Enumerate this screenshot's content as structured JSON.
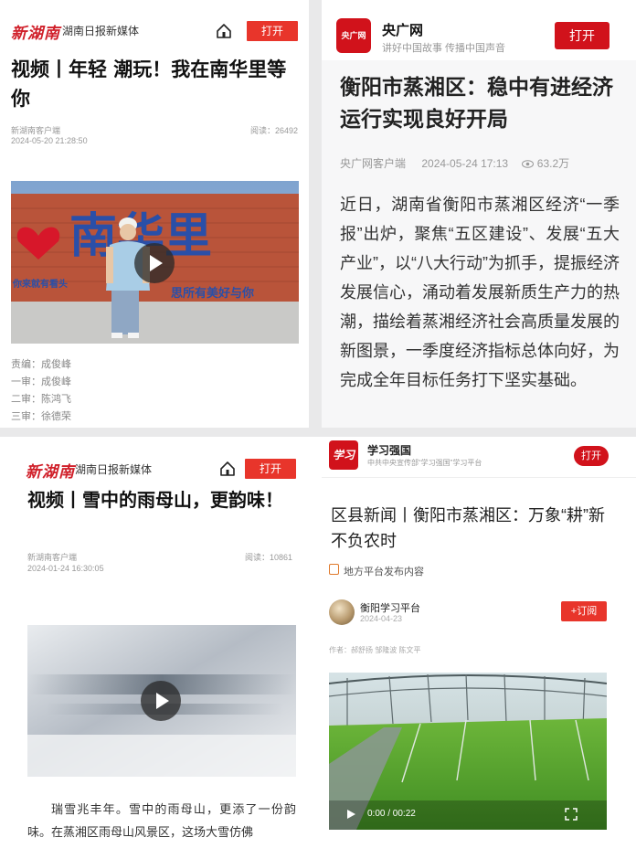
{
  "panel_a": {
    "logo": "新湖南",
    "source": "湖南日报新媒体",
    "open": "打开",
    "title": "视频丨年轻 潮玩！我在南华里等你",
    "author": "新湖南客户端",
    "datetime": "2024-05-20 21:28:50",
    "reads": "阅读：26492",
    "editors": [
      "责编：成俊峰",
      "一审：成俊峰",
      "二审：陈鸿飞",
      "三审：徐德荣"
    ],
    "video_sign": "南华里",
    "video_sign_sub": "思所有美好与你",
    "video_left_text": "你来就有看头"
  },
  "panel_b": {
    "brand": "央广网",
    "logo_text": "央广网",
    "slogan": "讲好中国故事 传播中国声音",
    "open": "打开",
    "title": "衡阳市蒸湘区：稳中有进经济运行实现良好开局",
    "source": "央广网客户端",
    "datetime": "2024-05-24 17:13",
    "views": "63.2万",
    "body": "近日，湖南省衡阳市蒸湘区经济“一季报”出炉，聚焦“五区建设”、发展“五大产业”，以“八大行动”为抓手，提振经济发展信心，涌动着发展新质生产力的热潮，描绘着蒸湘经济社会高质量发展的新图景，一季度经济指标总体向好，为完成全年目标任务打下坚实基础。"
  },
  "panel_c": {
    "logo": "新湖南",
    "source": "湖南日报新媒体",
    "open": "打开",
    "title": "视频丨雪中的雨母山，更韵味！",
    "author": "新湖南客户端",
    "datetime": "2024-01-24 16:30:05",
    "reads": "阅读：10861",
    "body": "瑞雪兆丰年。雪中的雨母山，更添了一份韵味。在蒸湘区雨母山风景区，这场大雪仿佛"
  },
  "panel_d": {
    "brand": "学习强国",
    "logo_text": "学习",
    "subtitle": "中共中央宣传部“学习强国”学习平台",
    "open": "打开",
    "title": "区县新闻丨衡阳市蒸湘区：万象“耕”新 不负农时",
    "tag": "地方平台发布内容",
    "account": "衡阳学习平台",
    "date": "2024-04-23",
    "subscribe": "+订阅",
    "authors": "作者：郝舒扬 邹隆波 陈文平",
    "time": "0:00 / 00:22"
  },
  "colors": {
    "brand_red": "#d1121b",
    "button_red": "#e8352b"
  }
}
